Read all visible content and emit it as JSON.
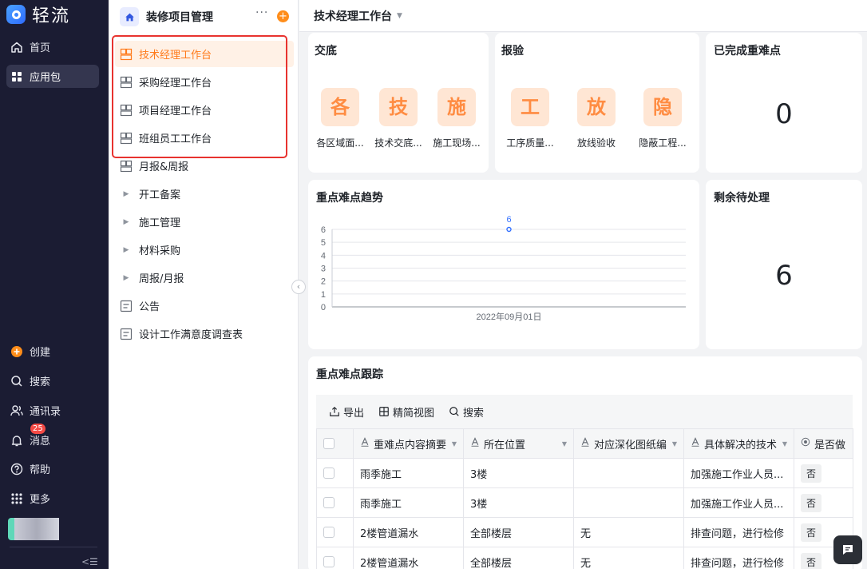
{
  "app": {
    "name": "轻流"
  },
  "rail": {
    "items": [
      {
        "label": "首页",
        "icon": "home-icon"
      },
      {
        "label": "应用包",
        "icon": "apps-grid-icon"
      },
      {
        "label": "创建",
        "icon": "plus-circle-icon"
      },
      {
        "label": "搜索",
        "icon": "search-icon"
      },
      {
        "label": "通讯录",
        "icon": "contacts-icon"
      },
      {
        "label": "消息",
        "icon": "bell-icon",
        "badge": "25"
      },
      {
        "label": "帮助",
        "icon": "help-icon"
      },
      {
        "label": "更多",
        "icon": "more-grid-icon"
      }
    ],
    "collapse_label": "<☰"
  },
  "nav": {
    "title": "装修项目管理",
    "more_label": "···",
    "add_label": "+",
    "items": [
      {
        "label": "技术经理工作台",
        "icon": "dashboard-icon"
      },
      {
        "label": "采购经理工作台",
        "icon": "dashboard-icon"
      },
      {
        "label": "项目经理工作台",
        "icon": "dashboard-icon"
      },
      {
        "label": "班组员工工作台",
        "icon": "dashboard-icon"
      },
      {
        "label": "月报&周报",
        "icon": "dashboard-icon"
      },
      {
        "label": "开工备案",
        "icon": "caret-right-icon"
      },
      {
        "label": "施工管理",
        "icon": "caret-right-icon"
      },
      {
        "label": "材料采购",
        "icon": "caret-right-icon"
      },
      {
        "label": "周报/月报",
        "icon": "caret-right-icon"
      },
      {
        "label": "公告",
        "icon": "form-icon"
      },
      {
        "label": "设计工作满意度调查表",
        "icon": "form-icon"
      }
    ],
    "active_index": 0
  },
  "topbar": {
    "title": "技术经理工作台"
  },
  "cards": {
    "jiaodi": {
      "title": "交底",
      "entries": [
        {
          "char": "各",
          "label": "各区域面..."
        },
        {
          "char": "技",
          "label": "技术交底..."
        },
        {
          "char": "施",
          "label": "施工现场..."
        }
      ]
    },
    "baoyan": {
      "title": "报验",
      "entries": [
        {
          "char": "工",
          "label": "工序质量..."
        },
        {
          "char": "放",
          "label": "放线验收"
        },
        {
          "char": "隐",
          "label": "隐蔽工程..."
        }
      ]
    },
    "completed": {
      "title": "已完成重难点",
      "value": "0"
    },
    "remaining": {
      "title": "剩余待处理",
      "value": "6"
    },
    "trend": {
      "title": "重点难点趋势"
    }
  },
  "chart_data": {
    "type": "line",
    "title": "重点难点趋势",
    "x": [
      "2022年09月01日"
    ],
    "series": [
      {
        "values": [
          6
        ]
      }
    ],
    "ylim": [
      0,
      6
    ],
    "yticks": [
      0,
      1,
      2,
      3,
      4,
      5,
      6
    ],
    "grid": true,
    "point_color": "#3370ff"
  },
  "tracking": {
    "title": "重点难点跟踪",
    "toolbar": {
      "export": "导出",
      "compact_view": "精简视图",
      "search": "搜索"
    },
    "columns": [
      {
        "label": "重难点内容摘要",
        "type_icon": "text-type-icon"
      },
      {
        "label": "所在位置",
        "type_icon": "text-type-icon"
      },
      {
        "label": "对应深化图纸编",
        "type_icon": "text-type-icon"
      },
      {
        "label": "具体解决的技术",
        "type_icon": "text-type-icon"
      },
      {
        "label": "是否做",
        "type_icon": "radio-type-icon"
      }
    ],
    "rows": [
      [
        "雨季施工",
        "3楼",
        "",
        "加强施工作业人员...",
        "否"
      ],
      [
        "雨季施工",
        "3楼",
        "",
        "加强施工作业人员...",
        "否"
      ],
      [
        "2楼管道漏水",
        "全部楼层",
        "无",
        "排查问题，进行检修",
        "否"
      ],
      [
        "2楼管道漏水",
        "全部楼层",
        "无",
        "排查问题，进行检修",
        "否"
      ]
    ]
  },
  "colors": {
    "accent": "#ff7a1a",
    "rail_bg": "#1b1c33",
    "highlight_frame": "#e8332f",
    "tile_bg": "#ffe6d4"
  }
}
